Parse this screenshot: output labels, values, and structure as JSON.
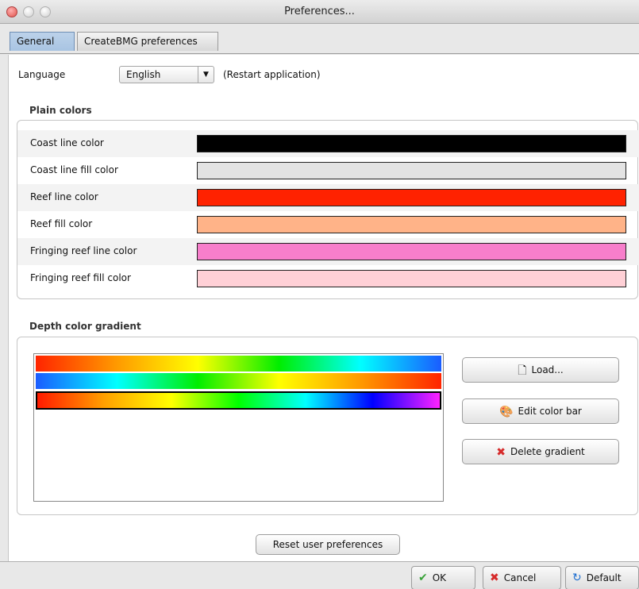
{
  "window": {
    "title": "Preferences..."
  },
  "tabs": [
    {
      "label": "General",
      "active": true
    },
    {
      "label": "CreateBMG preferences",
      "active": false
    }
  ],
  "language": {
    "label": "Language",
    "selected": "English",
    "hint": "(Restart application)"
  },
  "plain_colors": {
    "title": "Plain colors",
    "rows": [
      {
        "label": "Coast line color",
        "color": "#000000"
      },
      {
        "label": "Coast line fill color",
        "color": "#e3e3e3"
      },
      {
        "label": "Reef line color",
        "color": "#ff2200"
      },
      {
        "label": "Reef fill color",
        "color": "#ffb388"
      },
      {
        "label": "Fringing reef line color",
        "color": "#f77ecb"
      },
      {
        "label": "Fringing reef fill color",
        "color": "#ffd0d6"
      }
    ]
  },
  "depth_gradient": {
    "title": "Depth color gradient",
    "gradients": [
      {
        "colors": [
          "#ff2400",
          "#ff9a00",
          "#ffff00",
          "#00ee00",
          "#00ffff",
          "#1a5cff"
        ],
        "selected": false
      },
      {
        "colors": [
          "#1a5cff",
          "#00ffff",
          "#00ee00",
          "#ffff00",
          "#ff9a00",
          "#ff2400"
        ],
        "selected": false
      },
      {
        "colors": [
          "#ff1a00",
          "#ffa000",
          "#ffff00",
          "#00ff00",
          "#00ffff",
          "#0000ff",
          "#ff22ff"
        ],
        "selected": true
      }
    ],
    "buttons": {
      "load": "Load...",
      "edit": "Edit color bar",
      "delete": "Delete gradient"
    }
  },
  "reset_label": "Reset user preferences",
  "footer": {
    "ok": "OK",
    "cancel": "Cancel",
    "default": "Default"
  },
  "colors": {
    "ok_check": "#3aa33a",
    "cancel_x": "#d62b2b",
    "default_icon": "#1f6fd0"
  }
}
